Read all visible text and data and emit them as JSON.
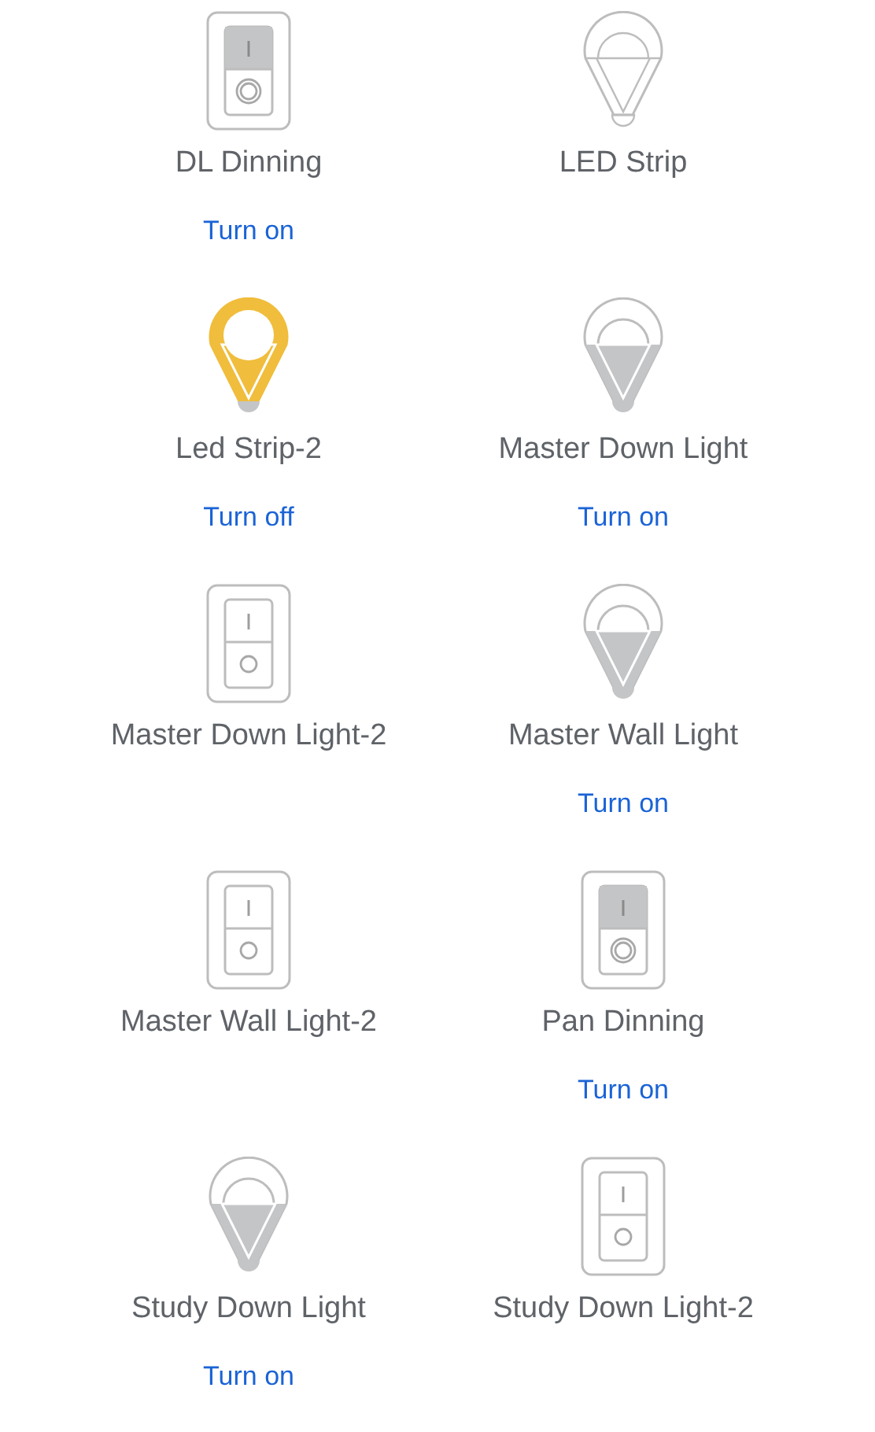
{
  "devices": [
    {
      "name": "DL Dinning",
      "kind": "switch",
      "on": false,
      "disabled": false,
      "action": "Turn on"
    },
    {
      "name": "LED Strip",
      "kind": "bulb",
      "disabled": true
    },
    {
      "name": "Led Strip-2",
      "kind": "bulb",
      "on": true,
      "disabled": false,
      "action": "Turn off"
    },
    {
      "name": "Master Down Light",
      "kind": "bulb",
      "on": false,
      "disabled": false,
      "action": "Turn on"
    },
    {
      "name": "Master Down Light-2",
      "kind": "switch",
      "disabled": true
    },
    {
      "name": "Master Wall Light",
      "kind": "bulb",
      "on": false,
      "disabled": false,
      "action": "Turn on"
    },
    {
      "name": "Master Wall Light-2",
      "kind": "switch",
      "disabled": true
    },
    {
      "name": "Pan Dinning",
      "kind": "switch",
      "on": false,
      "disabled": false,
      "action": "Turn on"
    },
    {
      "name": "Study Down Light",
      "kind": "bulb",
      "on": false,
      "disabled": false,
      "action": "Turn on"
    },
    {
      "name": "Study Down Light-2",
      "kind": "switch",
      "disabled": true
    }
  ]
}
